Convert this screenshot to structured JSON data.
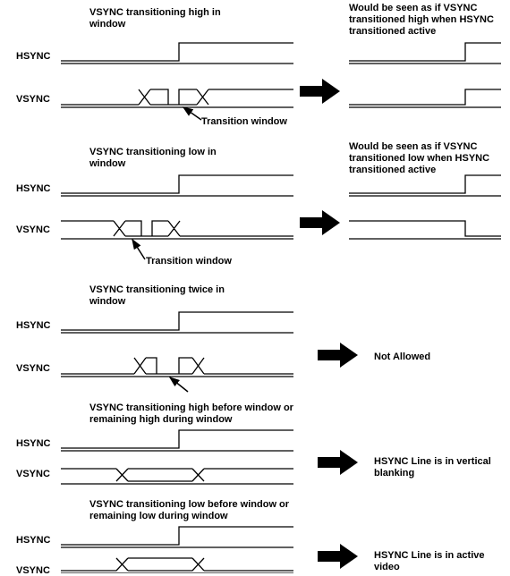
{
  "signals": {
    "hsync": "HSYNC",
    "vsync": "VSYNC"
  },
  "case1": {
    "title": "VSYNC transitioning high in window",
    "vsync_label": "Transition window",
    "result": "Would be seen as if VSYNC transitioned high when HSYNC transitioned active"
  },
  "case2": {
    "title": "VSYNC transitioning low in window",
    "vsync_label": "Transition window",
    "result": "Would be seen as if VSYNC transitioned low when HSYNC transitioned active"
  },
  "case3": {
    "title": "VSYNC transitioning twice in window",
    "result": "Not Allowed"
  },
  "case4": {
    "title": "VSYNC transitioning high before window or remaining high during window",
    "result": "HSYNC Line is in vertical blanking"
  },
  "case5": {
    "title": "VSYNC transitioning low before window or remaining low during window",
    "result": "HSYNC Line is in active video"
  }
}
